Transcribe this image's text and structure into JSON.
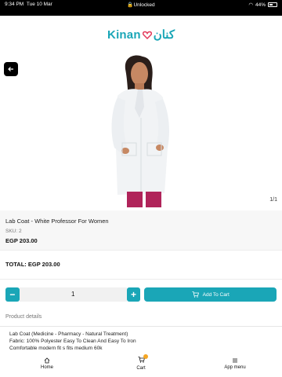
{
  "status": {
    "time": "9:34 PM",
    "date": "Tue 10 Mar",
    "center": "Unlocked",
    "battery": "44%"
  },
  "brand": {
    "logo_latin": "Kinan",
    "logo_arabic": "كنان",
    "accent": "#1aa6b7",
    "heart": "#e2395b"
  },
  "gallery": {
    "pager": "1/1"
  },
  "product": {
    "title": "Lab Coat - White Professor For Women",
    "sku": "SKU: 2",
    "price": "EGP 203.00",
    "total": "TOTAL: EGP 203.00",
    "quantity": "1",
    "add_label": "Add To Cart"
  },
  "details": {
    "heading": "Product details",
    "lines": [
      "Lab Coat (Medicine - Pharmacy - Natural Treatment)",
      "Fabric: 100% Polyester Easy To Clean And Easy To Iron",
      "Comfortable modern fit s fits medium 60k"
    ]
  },
  "nav": {
    "home": "Home",
    "cart": "Cart",
    "menu": "App menu"
  }
}
